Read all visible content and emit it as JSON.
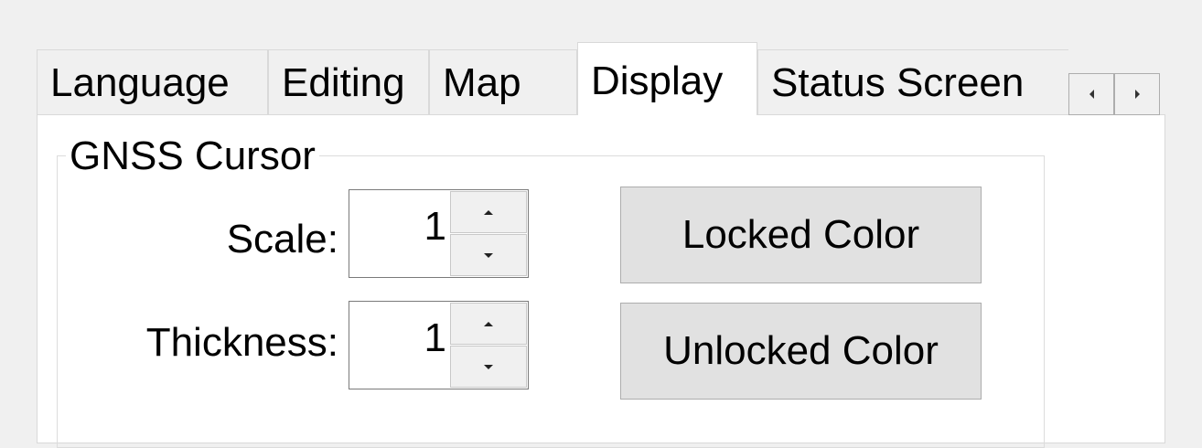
{
  "tabs": [
    {
      "label": "Language",
      "selected": false
    },
    {
      "label": "Editing",
      "selected": false
    },
    {
      "label": "Map",
      "selected": false
    },
    {
      "label": "Display",
      "selected": true
    },
    {
      "label": "Status Screen",
      "selected": false
    }
  ],
  "tab_scroll": {
    "left_icon": "triangle-left-icon",
    "right_icon": "triangle-right-icon"
  },
  "gnss_cursor": {
    "title": "GNSS Cursor",
    "scale": {
      "label": "Scale:",
      "value": "1"
    },
    "thickness": {
      "label": "Thickness:",
      "value": "1"
    },
    "locked_color_button": "Locked Color",
    "unlocked_color_button": "Unlocked Color"
  },
  "colors": {
    "window_background": "#f0f0f0",
    "tab_page_background": "#ffffff",
    "button_face": "#e1e1e1",
    "border": "#adadad"
  }
}
